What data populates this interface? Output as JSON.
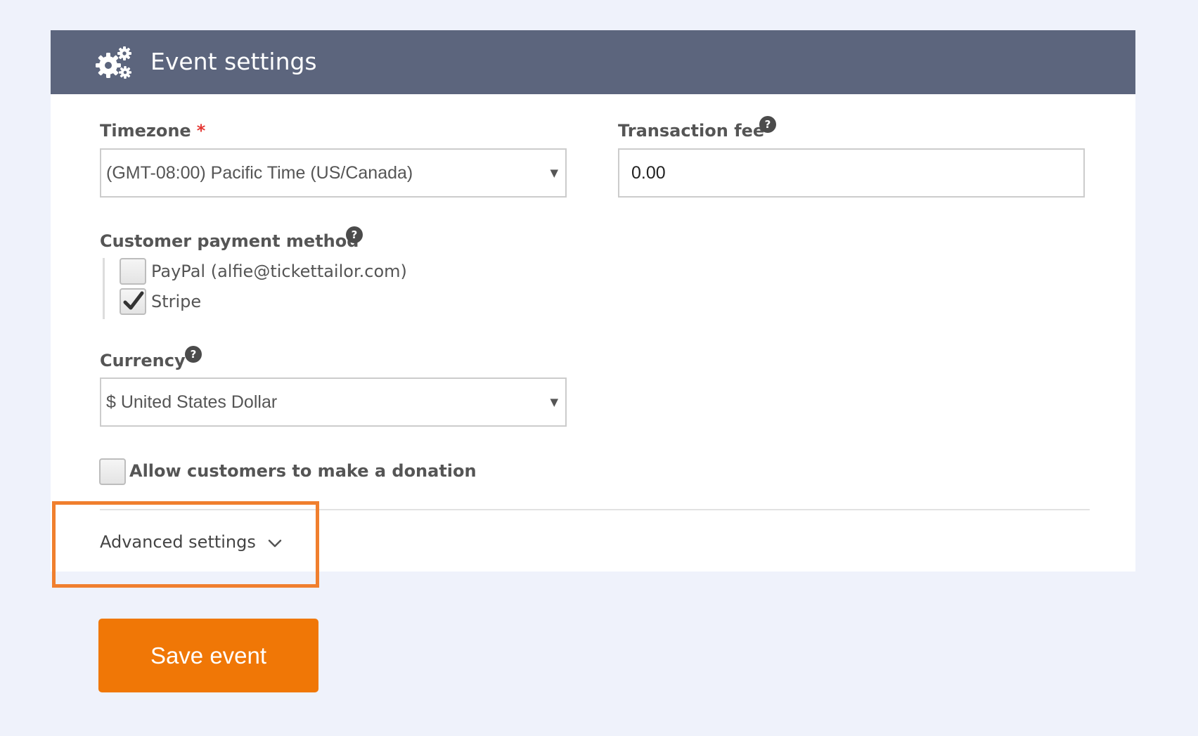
{
  "header": {
    "title": "Event settings",
    "icon": "gear-icon"
  },
  "timezone": {
    "label": "Timezone",
    "required_marker": "*",
    "selected": "(GMT-08:00) Pacific Time (US/Canada)"
  },
  "transaction_fee": {
    "label": "Transaction fee",
    "value": "0.00"
  },
  "payment_method": {
    "label": "Customer payment method",
    "options": [
      {
        "label": "PayPal (alfie@tickettailor.com)",
        "checked": false
      },
      {
        "label": "Stripe",
        "checked": true
      }
    ]
  },
  "currency": {
    "label": "Currency",
    "selected": "$ United States Dollar"
  },
  "donation": {
    "label": "Allow customers to make a donation",
    "checked": false
  },
  "advanced": {
    "label": "Advanced settings"
  },
  "actions": {
    "save_label": "Save event"
  },
  "help_glyph": "?",
  "caret_glyph": "▼",
  "colors": {
    "header_bg": "#5c657d",
    "accent": "#f07706",
    "highlight": "#f07f2e",
    "required": "#e53935"
  }
}
